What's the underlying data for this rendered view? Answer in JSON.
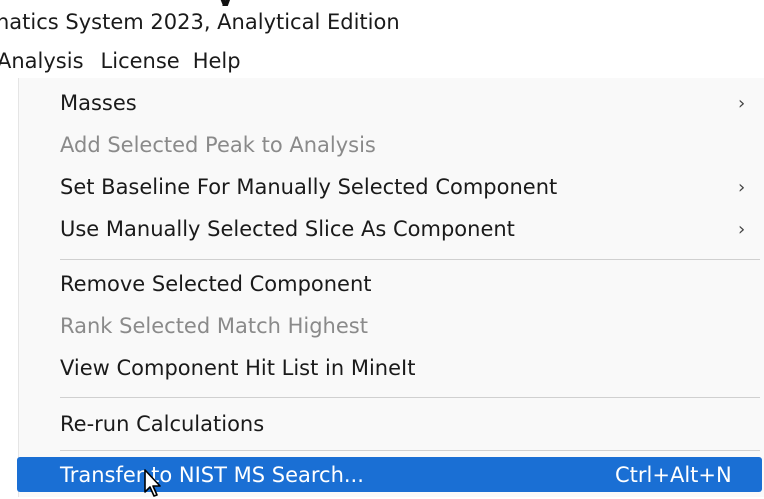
{
  "window": {
    "title_cutoff": "y",
    "title": "natics System 2023, Analytical Edition"
  },
  "menu_bar": {
    "items": [
      {
        "label": "Analysis"
      },
      {
        "label": "License"
      },
      {
        "label": "Help"
      }
    ]
  },
  "dropdown": {
    "items": [
      {
        "label": "Masses",
        "enabled": true,
        "submenu": true
      },
      {
        "label": "Add Selected Peak to Analysis",
        "enabled": false,
        "submenu": false
      },
      {
        "label": "Set Baseline For Manually Selected Component",
        "enabled": true,
        "submenu": true
      },
      {
        "label": "Use Manually Selected Slice As Component",
        "enabled": true,
        "submenu": true
      },
      {
        "label": "Remove Selected Component",
        "enabled": true,
        "submenu": false
      },
      {
        "label": "Rank Selected Match Highest",
        "enabled": false,
        "submenu": false
      },
      {
        "label": "View Component Hit List in MineIt",
        "enabled": true,
        "submenu": false
      },
      {
        "label": "Re-run Calculations",
        "enabled": true,
        "submenu": false
      },
      {
        "label": "Transfer to NIST MS Search...",
        "enabled": true,
        "submenu": false,
        "highlighted": true,
        "shortcut": "Ctrl+Alt+N"
      }
    ],
    "submenu_arrow": "›"
  },
  "colors": {
    "highlight": "#1a6fd4",
    "disabled_text": "#8a8a8a",
    "menu_background": "#f9f9f9"
  },
  "icons": {
    "cursor": "arrow-pointer-icon",
    "submenu": "chevron-right-icon"
  }
}
